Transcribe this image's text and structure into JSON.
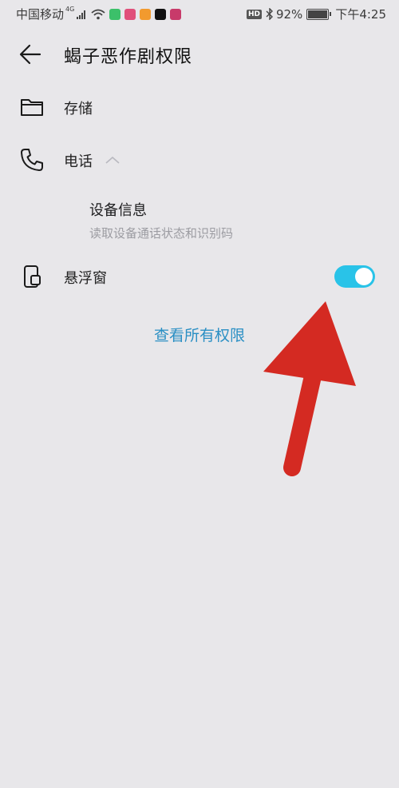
{
  "status_bar": {
    "carrier": "中国移动",
    "network": "4G",
    "hd": "HD",
    "battery": "92%",
    "battery_level": 0.92,
    "time": "下午4:25"
  },
  "header": {
    "title": "蝎子恶作剧权限"
  },
  "permissions": [
    {
      "label": "存储",
      "icon": "folder-icon"
    },
    {
      "label": "电话",
      "icon": "phone-icon",
      "expanded": true,
      "children": [
        {
          "title": "设备信息",
          "description": "读取设备通话状态和识别码"
        }
      ]
    },
    {
      "label": "悬浮窗",
      "icon": "floating-window-icon",
      "toggle_on": true
    }
  ],
  "view_all_link": "查看所有权限",
  "colors": {
    "accent": "#29c3e8",
    "link": "#2a8fc4",
    "annotation_arrow": "#d42a22",
    "background": "#e8e7ea"
  }
}
